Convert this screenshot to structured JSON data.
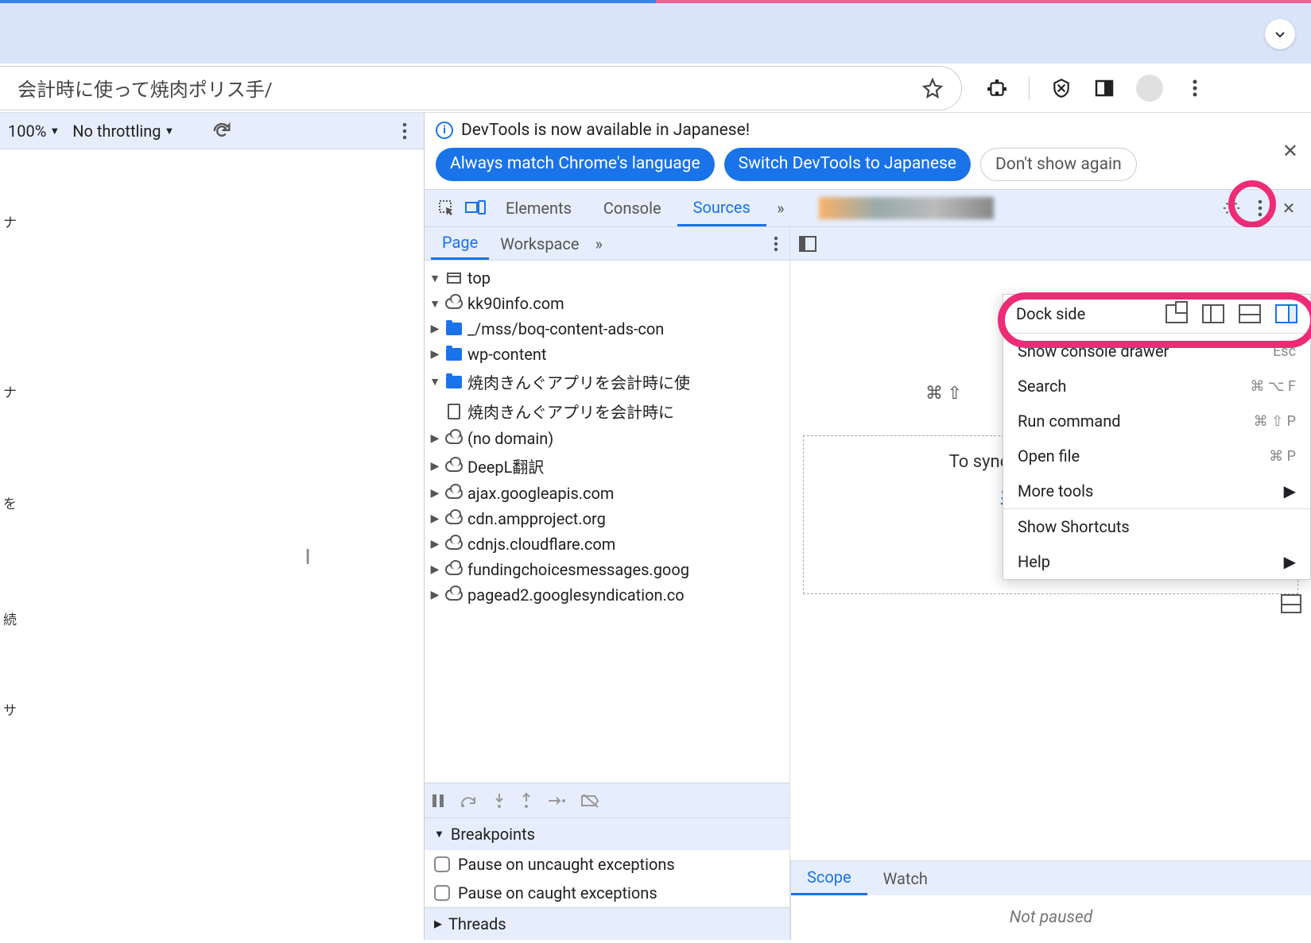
{
  "url": "会計時に使って焼肉ポリス手/",
  "leftPane": {
    "zoom": "100%",
    "throttle": "No throttling",
    "sideTexts": [
      "ナ",
      "ナ",
      "を",
      "続",
      "サ"
    ]
  },
  "infobar": {
    "message": "DevTools is now available in Japanese!",
    "pill1": "Always match Chrome's language",
    "pill2": "Switch DevTools to Japanese",
    "pill3": "Don't show again"
  },
  "tabs": {
    "elements": "Elements",
    "console": "Console",
    "sources": "Sources"
  },
  "subtabs": {
    "page": "Page",
    "workspace": "Workspace"
  },
  "tree": {
    "top": "top",
    "domain": "kk90info.com",
    "f1": "_/mss/boq-content-ads-con",
    "f2": "wp-content",
    "f3": "焼肉きんぐアプリを会計時に使",
    "file": "焼肉きんぐアプリを会計時に",
    "c1": "(no domain)",
    "c2": "DeepL翻訳",
    "c3": "ajax.googleapis.com",
    "c4": "cdn.ampproject.org",
    "c5": "cdnjs.cloudflare.com",
    "c6": "fundingchoicesmessages.goog",
    "c7": "pagead2.googlesyndication.co"
  },
  "editor": {
    "kbhint": "⌘ ⇧",
    "droptext": "To sync edits a folder with",
    "selectfolder": "Select folder"
  },
  "breakpoints": {
    "title": "Breakpoints",
    "r1": "Pause on uncaught exceptions",
    "r2": "Pause on caught exceptions",
    "threads": "Threads"
  },
  "scope": {
    "scope": "Scope",
    "watch": "Watch",
    "notpaused": "Not paused"
  },
  "popup": {
    "dock": "Dock side",
    "r1": "Show console drawer",
    "s1": "Esc",
    "r2": "Search",
    "s2": "⌘ ⌥ F",
    "r3": "Run command",
    "s3": "⌘ ⇧ P",
    "r4": "Open file",
    "s4": "⌘ P",
    "r5": "More tools",
    "r6": "Show Shortcuts",
    "r7": "Help"
  }
}
